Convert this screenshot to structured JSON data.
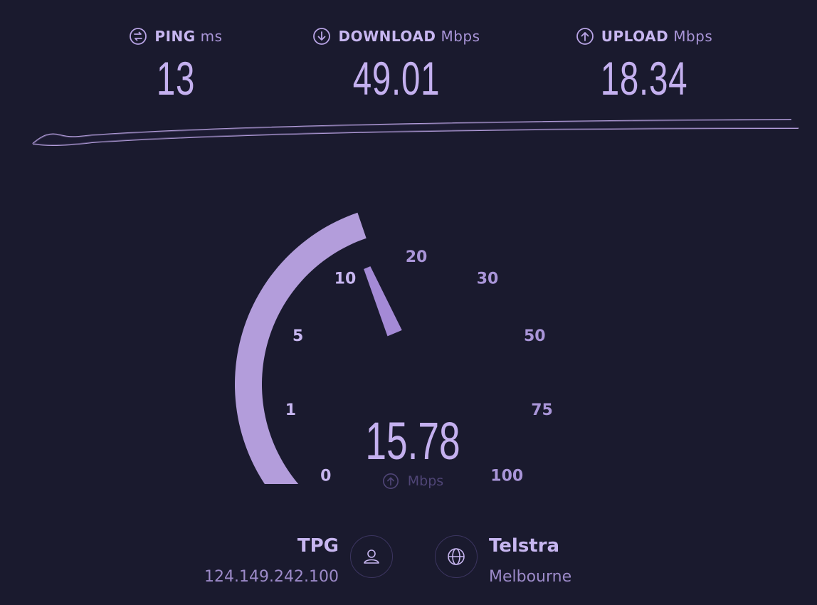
{
  "metrics": {
    "ping": {
      "label": "PING",
      "unit": "ms",
      "value": "13",
      "icon": "ping-icon"
    },
    "download": {
      "label": "DOWNLOAD",
      "unit": "Mbps",
      "value": "49.01",
      "icon": "download-arrow-icon"
    },
    "upload": {
      "label": "UPLOAD",
      "unit": "Mbps",
      "value": "18.34",
      "icon": "upload-arrow-icon"
    }
  },
  "gauge": {
    "ticks": [
      "0",
      "1",
      "5",
      "10",
      "20",
      "30",
      "50",
      "75",
      "100"
    ],
    "current_value": "15.78",
    "fill_level": 0.43,
    "unit": "Mbps",
    "unit_icon": "upload-arrow-icon"
  },
  "client": {
    "isp": "TPG",
    "ip": "124.149.242.100",
    "icon": "user-icon"
  },
  "server": {
    "name": "Telstra",
    "location": "Melbourne",
    "icon": "globe-icon"
  },
  "colors": {
    "background": "#1a1a2e",
    "accent": "#b39ddb",
    "text": "#c7b6f0",
    "muted": "#4f4576"
  }
}
